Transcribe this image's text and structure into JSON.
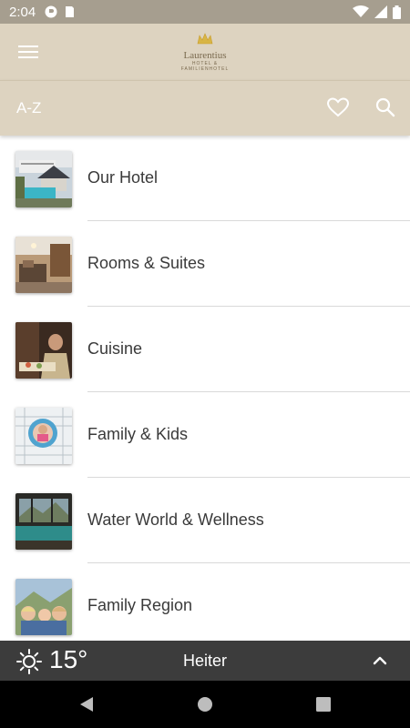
{
  "status_bar": {
    "time": "2:04",
    "left_icons": [
      "app-notification-icon",
      "sd-card-icon"
    ],
    "right_icons": [
      "wifi-icon",
      "cellular-icon",
      "battery-icon"
    ]
  },
  "app_bar": {
    "menu_icon": "hamburger-menu-icon",
    "logo_text": "Laurentius",
    "logo_subtext": "HOTEL & FAMILIENHOTEL",
    "background": "#ddd3c0"
  },
  "sub_bar": {
    "az_label": "A-Z",
    "favorite_icon": "heart-icon",
    "search_icon": "search-icon"
  },
  "list": {
    "items": [
      {
        "label": "Our Hotel",
        "thumb": "hotel-photo"
      },
      {
        "label": "Rooms & Suites",
        "thumb": "room-photo"
      },
      {
        "label": "Cuisine",
        "thumb": "chef-photo"
      },
      {
        "label": "Family & Kids",
        "thumb": "kids-photo"
      },
      {
        "label": "Water World & Wellness",
        "thumb": "pool-photo"
      },
      {
        "label": "Family Region",
        "thumb": "family-photo"
      }
    ]
  },
  "weather": {
    "icon": "sun-icon",
    "temperature": "15°",
    "description": "Heiter",
    "expand_icon": "chevron-up-icon"
  },
  "nav_bar": {
    "buttons": [
      "back-icon",
      "home-icon",
      "recents-icon"
    ]
  }
}
